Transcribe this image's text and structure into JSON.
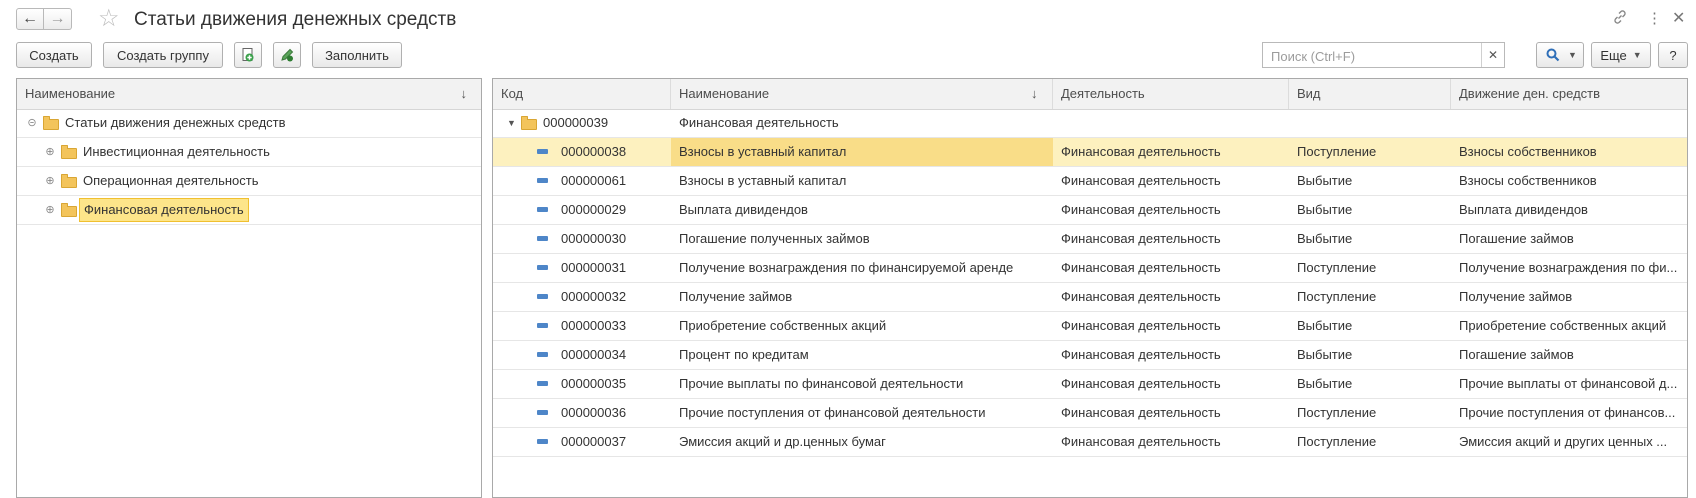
{
  "window": {
    "title": "Статьи движения денежных средств",
    "back_icon": "arrow-left-icon",
    "forward_icon": "arrow-right-icon",
    "favorite_icon": "star-icon",
    "link_icon": "link-icon",
    "more_icon": "more-vertical-icon",
    "close_icon": "close-icon"
  },
  "toolbar": {
    "create_label": "Создать",
    "create_group_label": "Создать группу",
    "fill_label": "Заполнить",
    "search_placeholder": "Поиск (Ctrl+F)",
    "more_label": "Еще",
    "help_label": "?"
  },
  "tree": {
    "header": "Наименование",
    "root": "Статьи движения денежных средств",
    "children": [
      {
        "label": "Инвестиционная деятельность"
      },
      {
        "label": "Операционная деятельность"
      },
      {
        "label": "Финансовая деятельность",
        "selected": true
      }
    ]
  },
  "table": {
    "columns": [
      "Код",
      "Наименование",
      "Деятельность",
      "Вид",
      "Движение ден. средств"
    ],
    "group": {
      "code": "000000039",
      "name": "Финансовая деятельность"
    },
    "rows": [
      {
        "code": "000000038",
        "name": "Взносы в уставный капитал",
        "activity": "Финансовая  деятельность",
        "kind": "Поступление",
        "movement": "Взносы собственников"
      },
      {
        "code": "000000061",
        "name": "Взносы в уставный капитал",
        "activity": "Финансовая  деятельность",
        "kind": "Выбытие",
        "movement": "Взносы собственников"
      },
      {
        "code": "000000029",
        "name": "Выплата дивидендов",
        "activity": "Финансовая  деятельность",
        "kind": "Выбытие",
        "movement": "Выплата дивидендов"
      },
      {
        "code": "000000030",
        "name": "Погашение полученных займов",
        "activity": "Финансовая  деятельность",
        "kind": "Выбытие",
        "movement": "Погашение займов"
      },
      {
        "code": "000000031",
        "name": "Получение вознаграждения по финансируемой аренде",
        "activity": "Финансовая  деятельность",
        "kind": "Поступление",
        "movement": "Получение вознаграждения по фи..."
      },
      {
        "code": "000000032",
        "name": "Получение займов",
        "activity": "Финансовая  деятельность",
        "kind": "Поступление",
        "movement": "Получение займов"
      },
      {
        "code": "000000033",
        "name": "Приобретение собственных акций",
        "activity": "Финансовая  деятельность",
        "kind": "Выбытие",
        "movement": "Приобретение собственных акций"
      },
      {
        "code": "000000034",
        "name": "Процент по кредитам",
        "activity": "Финансовая  деятельность",
        "kind": "Выбытие",
        "movement": "Погашение займов"
      },
      {
        "code": "000000035",
        "name": "Прочие выплаты по финансовой деятельности",
        "activity": "Финансовая  деятельность",
        "kind": "Выбытие",
        "movement": "Прочие выплаты от финансовой д..."
      },
      {
        "code": "000000036",
        "name": "Прочие поступления от финансовой деятельности",
        "activity": "Финансовая  деятельность",
        "kind": "Поступление",
        "movement": "Прочие поступления от финансов..."
      },
      {
        "code": "000000037",
        "name": "Эмиссия акций и др.ценных бумаг",
        "activity": "Финансовая  деятельность",
        "kind": "Поступление",
        "movement": "Эмиссия акций и  других ценных ..."
      }
    ]
  }
}
